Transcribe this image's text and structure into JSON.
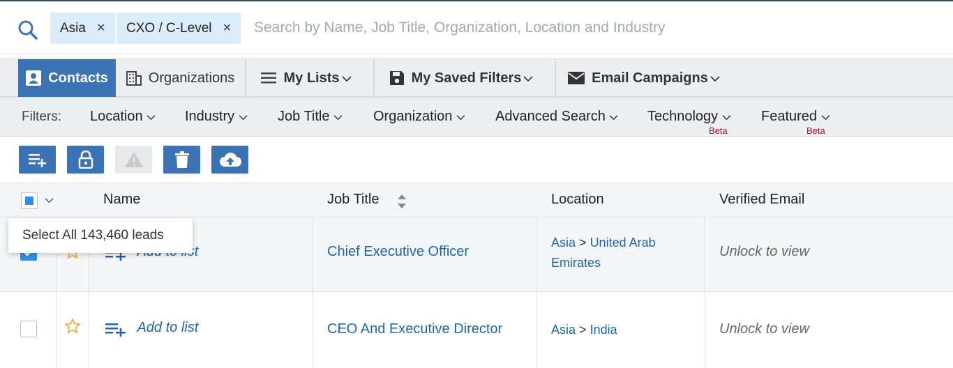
{
  "search": {
    "chips": [
      {
        "label": "Asia",
        "remove": "×"
      },
      {
        "label": "CXO / C-Level",
        "remove": "×"
      }
    ],
    "placeholder": "Search by Name, Job Title, Organization, Location and Industry"
  },
  "tabs": [
    {
      "label": "Contacts"
    },
    {
      "label": "Organizations"
    },
    {
      "label": "My Lists"
    },
    {
      "label": "My Saved Filters"
    },
    {
      "label": "Email Campaigns"
    }
  ],
  "filters": {
    "label": "Filters:",
    "items": [
      {
        "label": "Location"
      },
      {
        "label": "Industry"
      },
      {
        "label": "Job Title"
      },
      {
        "label": "Organization"
      },
      {
        "label": "Advanced Search"
      },
      {
        "label": "Technology",
        "badge": "Beta"
      },
      {
        "label": "Featured",
        "badge": "Beta"
      }
    ]
  },
  "actions": [
    "add-to-list-icon",
    "unlock-icon",
    "warning-icon",
    "trash-icon",
    "cloud-upload-icon"
  ],
  "table": {
    "columns": [
      "Name",
      "Job Title",
      "Location",
      "Verified Email"
    ],
    "rows": [
      {
        "selected": true,
        "add_to_list": "Add to list",
        "job_title": "Chief Executive Officer",
        "region": "Asia",
        "separator": ">",
        "country": "United Arab Emirates",
        "email": "Unlock to view"
      },
      {
        "selected": false,
        "add_to_list": "Add to list",
        "job_title": "CEO And Executive Director",
        "region": "Asia",
        "separator": ">",
        "country": "India",
        "email": "Unlock to view"
      }
    ]
  },
  "tooltip": "Select All 143,460 leads",
  "colors": {
    "accent": "#3c73b4",
    "link": "#1f65a8",
    "chip": "#d9ecf7",
    "beta": "#d0021b",
    "star": "#f0a830"
  }
}
